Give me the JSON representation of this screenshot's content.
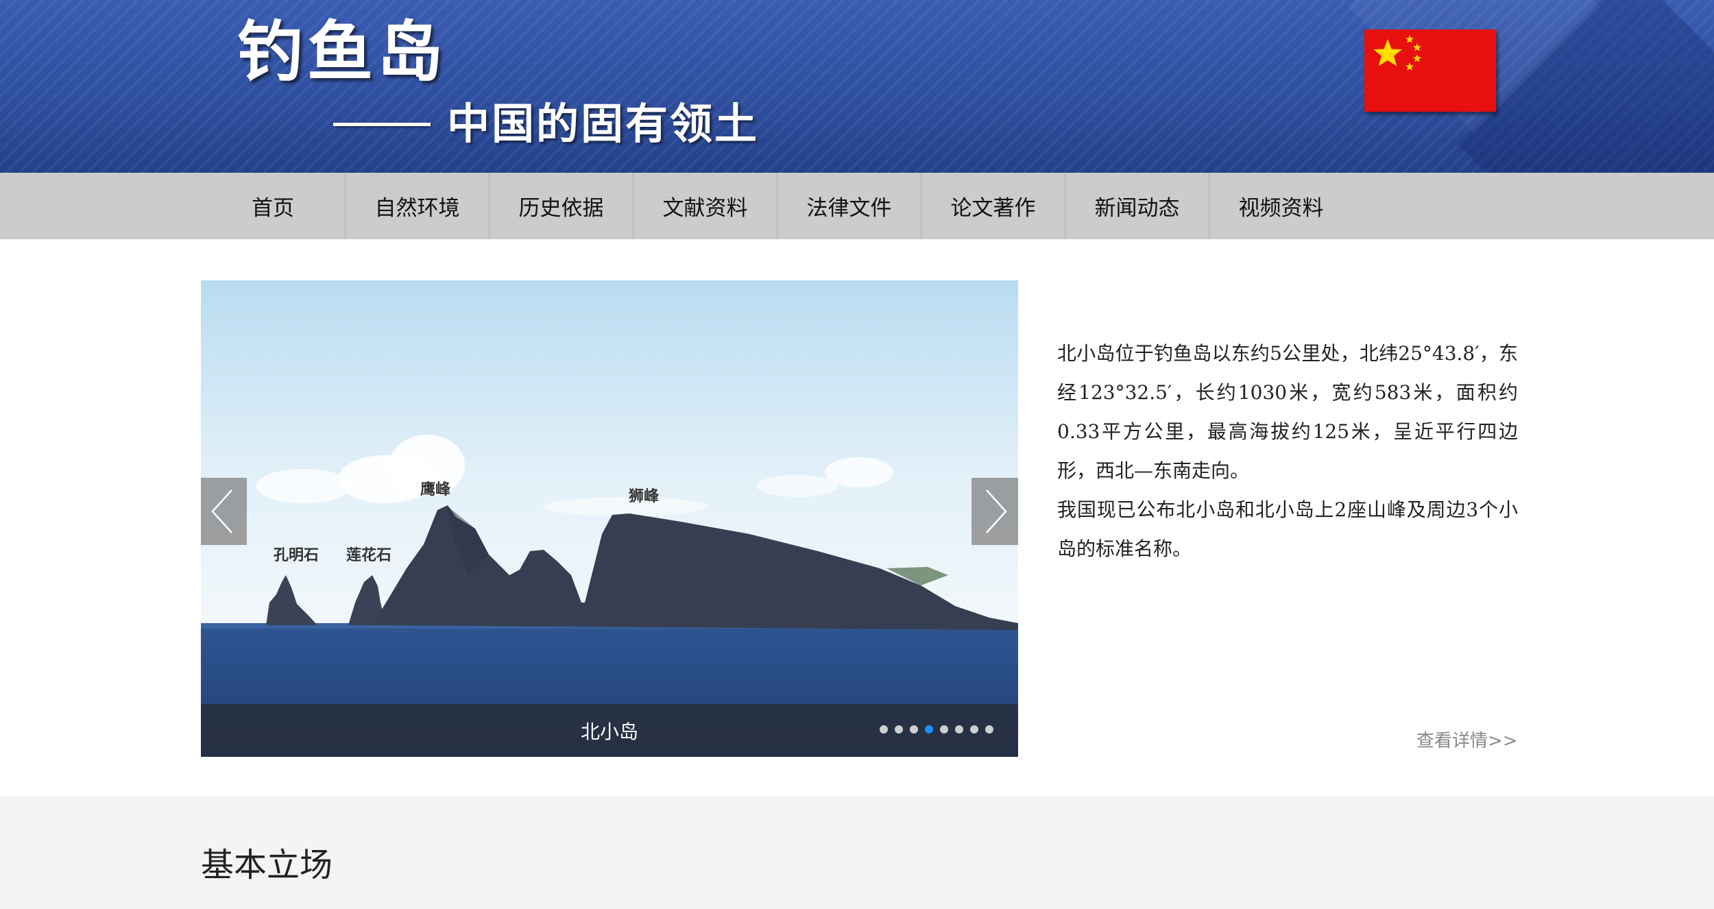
{
  "header": {
    "title": "钓鱼岛",
    "subtitle": "中国的固有领土",
    "flag_icon": "china-flag-icon",
    "colors": {
      "banner": "#2f4f9f",
      "flag": "#e8100e",
      "star": "#ffde00"
    }
  },
  "nav": {
    "items": [
      {
        "label": "首页"
      },
      {
        "label": "自然环境"
      },
      {
        "label": "历史依据"
      },
      {
        "label": "文献资料"
      },
      {
        "label": "法律文件"
      },
      {
        "label": "论文著作"
      },
      {
        "label": "新闻动态"
      },
      {
        "label": "视频资料"
      }
    ]
  },
  "slider": {
    "caption": "北小岛",
    "labels": {
      "kongming": "孔明石",
      "lianhua": "莲花石",
      "ying": "鹰峰",
      "shi": "狮峰"
    },
    "total_slides": 8,
    "active_index": 3,
    "prev_icon": "chevron-left-icon",
    "next_icon": "chevron-right-icon",
    "active_dot_color": "#1e90ff"
  },
  "description": {
    "paragraph1": "北小岛位于钓鱼岛以东约5公里处，北纬25°43.8′，东经123°32.5′，长约1030米，宽约583米，面积约0.33平方公里，最高海拔约125米，呈近平行四边形，西北—东南走向。",
    "paragraph2": "我国现已公布北小岛和北小岛上2座山峰及周边3个小岛的标准名称。",
    "more_link": "查看详情>>"
  },
  "section": {
    "title": "基本立场"
  }
}
